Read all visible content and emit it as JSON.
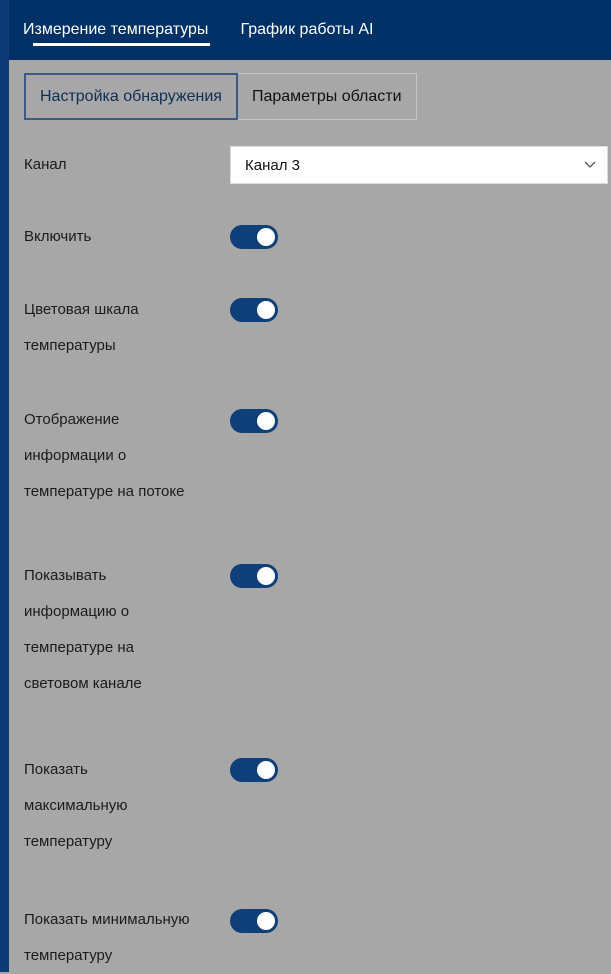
{
  "colors": {
    "nav_bg": "#003166",
    "accent": "#0e3f78",
    "panel_bg": "#a7a7a7",
    "active_subtab_border": "#3b5a85"
  },
  "nav": {
    "tabs": [
      {
        "label": "Измерение температуры",
        "active": true
      },
      {
        "label": "График работы AI",
        "active": false
      }
    ]
  },
  "subtabs": [
    {
      "label": "Настройка обнаружения",
      "active": true
    },
    {
      "label": "Параметры области",
      "active": false
    }
  ],
  "form": {
    "channel": {
      "label": "Канал",
      "value": "Канал 3",
      "icon": "chevron-down-icon"
    },
    "toggles": [
      {
        "lines": [
          "Включить"
        ],
        "on": true
      },
      {
        "lines": [
          "Цветовая шкала",
          "температуры"
        ],
        "on": true
      },
      {
        "lines": [
          "Отображение",
          "информации о",
          "температуре на потоке"
        ],
        "on": true
      },
      {
        "lines": [
          "Показывать",
          "информацию о",
          "температуре на",
          "световом канале"
        ],
        "on": true
      },
      {
        "lines": [
          "Показать",
          "максимальную",
          "температуру"
        ],
        "on": true
      },
      {
        "lines": [
          "Показать минимальную",
          "температуру"
        ],
        "on": true
      }
    ]
  }
}
